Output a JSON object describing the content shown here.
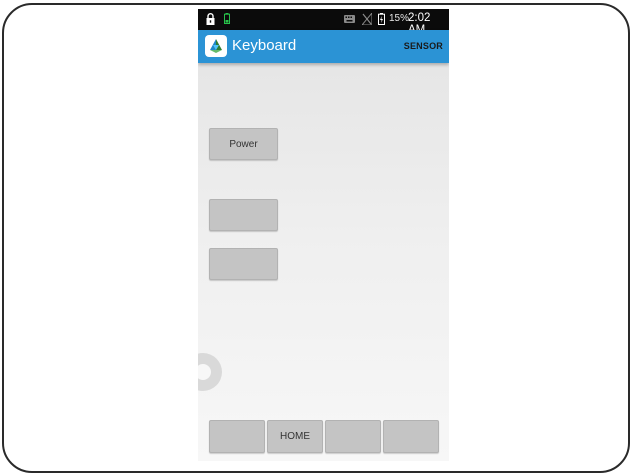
{
  "status_bar": {
    "battery_percent": "15%",
    "time": "2:02 AM",
    "icons": [
      "lock-icon",
      "battery-notification-icon",
      "keyboard-icon",
      "no-signal-icon",
      "battery-charging-icon"
    ]
  },
  "app_bar": {
    "title": "Keyboard",
    "action_label": "SENSOR",
    "color": "#2b93d5"
  },
  "main": {
    "buttons": [
      {
        "label": "Power"
      },
      {
        "label": ""
      },
      {
        "label": ""
      }
    ]
  },
  "nav_keys": [
    {
      "label": ""
    },
    {
      "label": "HOME"
    },
    {
      "label": ""
    },
    {
      "label": ""
    }
  ]
}
